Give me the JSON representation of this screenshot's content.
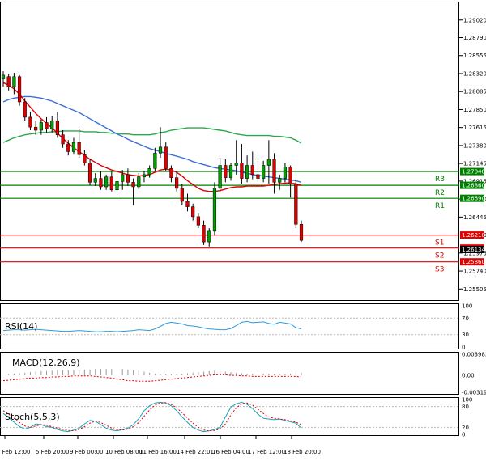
{
  "chart_data": [
    {
      "type": "candlestick",
      "panel": "price",
      "ylim": [
        1.2536,
        1.2925
      ],
      "y_ticks": [
        "1.29020",
        "1.28790",
        "1.28555",
        "1.28320",
        "1.28085",
        "1.27850",
        "1.27615",
        "1.27380",
        "1.27145",
        "1.26915",
        "1.26680",
        "1.26445",
        "1.26210",
        "1.25975",
        "1.25740",
        "1.25505"
      ],
      "x_labels": [
        "2 Feb 12:00",
        "5 Feb 20:00",
        "9 Feb 00:00",
        "10 Feb 08:00",
        "11 Feb 16:00",
        "14 Feb 22:01",
        "16 Feb 04:00",
        "17 Feb 12:00",
        "18 Feb 20:00"
      ],
      "colors": {
        "bull": "#00a000",
        "bear": "#e00000",
        "ma_fast": "#e00000",
        "ma_mid": "#3a6fd8",
        "ma_slow": "#2aa84a"
      },
      "candles": [
        [
          1.2825,
          1.2835,
          1.2815,
          1.283
        ],
        [
          1.2828,
          1.2832,
          1.281,
          1.2815
        ],
        [
          1.2815,
          1.2833,
          1.2805,
          1.2828
        ],
        [
          1.2828,
          1.283,
          1.279,
          1.2795
        ],
        [
          1.2795,
          1.28,
          1.277,
          1.2775
        ],
        [
          1.2775,
          1.2782,
          1.2758,
          1.2762
        ],
        [
          1.2762,
          1.277,
          1.2752,
          1.2758
        ],
        [
          1.2758,
          1.2772,
          1.2752,
          1.2768
        ],
        [
          1.2768,
          1.2775,
          1.2755,
          1.276
        ],
        [
          1.276,
          1.2776,
          1.2755,
          1.277
        ],
        [
          1.277,
          1.2782,
          1.2748,
          1.2752
        ],
        [
          1.2752,
          1.2758,
          1.2735,
          1.274
        ],
        [
          1.274,
          1.2745,
          1.2725,
          1.273
        ],
        [
          1.273,
          1.2748,
          1.2726,
          1.2742
        ],
        [
          1.2742,
          1.276,
          1.2722,
          1.2726
        ],
        [
          1.2726,
          1.2732,
          1.2712,
          1.2715
        ],
        [
          1.2715,
          1.272,
          1.2686,
          1.269
        ],
        [
          1.269,
          1.2702,
          1.2685,
          1.2695
        ],
        [
          1.2695,
          1.2705,
          1.268,
          1.2684
        ],
        [
          1.2684,
          1.27,
          1.268,
          1.2697
        ],
        [
          1.2697,
          1.2704,
          1.2678,
          1.268
        ],
        [
          1.268,
          1.2694,
          1.267,
          1.2691
        ],
        [
          1.2691,
          1.2706,
          1.268,
          1.27
        ],
        [
          1.27,
          1.2708,
          1.2685,
          1.269
        ],
        [
          1.269,
          1.2695,
          1.266,
          1.2684
        ],
        [
          1.2684,
          1.2702,
          1.2681,
          1.2697
        ],
        [
          1.2697,
          1.2705,
          1.269,
          1.27
        ],
        [
          1.27,
          1.2712,
          1.2696,
          1.2708
        ],
        [
          1.2708,
          1.2735,
          1.2704,
          1.2728
        ],
        [
          1.2728,
          1.2762,
          1.2722,
          1.2736
        ],
        [
          1.2736,
          1.2742,
          1.2704,
          1.2708
        ],
        [
          1.2708,
          1.2712,
          1.269,
          1.2696
        ],
        [
          1.2696,
          1.2705,
          1.2678,
          1.2682
        ],
        [
          1.2682,
          1.2688,
          1.266,
          1.2665
        ],
        [
          1.2665,
          1.2675,
          1.2652,
          1.2658
        ],
        [
          1.2658,
          1.2662,
          1.264,
          1.2645
        ],
        [
          1.2645,
          1.265,
          1.263,
          1.2634
        ],
        [
          1.2634,
          1.264,
          1.2608,
          1.2612
        ],
        [
          1.2612,
          1.263,
          1.2606,
          1.2626
        ],
        [
          1.2626,
          1.269,
          1.262,
          1.2682
        ],
        [
          1.2682,
          1.2722,
          1.2676,
          1.2712
        ],
        [
          1.2712,
          1.272,
          1.269,
          1.2696
        ],
        [
          1.2696,
          1.2715,
          1.2692,
          1.2712
        ],
        [
          1.2712,
          1.2745,
          1.27,
          1.2715
        ],
        [
          1.2715,
          1.274,
          1.2688,
          1.2695
        ],
        [
          1.2695,
          1.2725,
          1.269,
          1.2712
        ],
        [
          1.2712,
          1.273,
          1.2694,
          1.27
        ],
        [
          1.27,
          1.272,
          1.269,
          1.2695
        ],
        [
          1.2695,
          1.2718,
          1.269,
          1.2712
        ],
        [
          1.2712,
          1.2745,
          1.2688,
          1.272
        ],
        [
          1.272,
          1.2728,
          1.2675,
          1.269
        ],
        [
          1.269,
          1.27,
          1.268,
          1.2695
        ],
        [
          1.2695,
          1.2715,
          1.269,
          1.271
        ],
        [
          1.271,
          1.2712,
          1.267,
          1.2688
        ],
        [
          1.2688,
          1.2694,
          1.263,
          1.2635
        ],
        [
          1.2635,
          1.264,
          1.2612,
          1.2614
        ]
      ],
      "ma_fast": [
        1.282,
        1.2817,
        1.2812,
        1.2805,
        1.2796,
        1.2788,
        1.278,
        1.2773,
        1.2767,
        1.2761,
        1.2754,
        1.2747,
        1.2741,
        1.2735,
        1.273,
        1.2725,
        1.272,
        1.2716,
        1.2712,
        1.2709,
        1.2706,
        1.2704,
        1.2702,
        1.27,
        1.2699,
        1.2698,
        1.2699,
        1.27,
        1.2703,
        1.2706,
        1.2707,
        1.2706,
        1.2703,
        1.2698,
        1.2692,
        1.2687,
        1.2682,
        1.2679,
        1.2678,
        1.2678,
        1.2679,
        1.2681,
        1.2683,
        1.2684,
        1.2684,
        1.2685,
        1.2685,
        1.2685,
        1.2685,
        1.2686,
        1.2687,
        1.2688,
        1.2689,
        1.2689,
        1.2688,
        1.2686
      ],
      "ma_mid": [
        1.2795,
        1.2798,
        1.28,
        1.2801,
        1.2802,
        1.2802,
        1.2801,
        1.28,
        1.2798,
        1.2796,
        1.2793,
        1.279,
        1.2787,
        1.2784,
        1.2781,
        1.2777,
        1.2773,
        1.2769,
        1.2765,
        1.2761,
        1.2757,
        1.2753,
        1.275,
        1.2746,
        1.2743,
        1.274,
        1.2737,
        1.2734,
        1.2732,
        1.273,
        1.2728,
        1.2726,
        1.2724,
        1.2722,
        1.272,
        1.2717,
        1.2715,
        1.2713,
        1.2711,
        1.2709,
        1.2708,
        1.2707,
        1.2706,
        1.2705,
        1.2703,
        1.2702,
        1.27,
        1.2699,
        1.2698,
        1.2697,
        1.2696,
        1.2695,
        1.2694,
        1.2693,
        1.2692,
        1.269
      ],
      "ma_slow": [
        1.2742,
        1.2745,
        1.2748,
        1.275,
        1.2752,
        1.2753,
        1.2754,
        1.2755,
        1.2755,
        1.2756,
        1.2756,
        1.2757,
        1.2757,
        1.2757,
        1.2757,
        1.2756,
        1.2756,
        1.2756,
        1.2755,
        1.2755,
        1.2754,
        1.2754,
        1.2753,
        1.2753,
        1.2752,
        1.2752,
        1.2752,
        1.2752,
        1.2753,
        1.2755,
        1.2756,
        1.2758,
        1.2759,
        1.276,
        1.2761,
        1.2761,
        1.2761,
        1.2761,
        1.276,
        1.2759,
        1.2758,
        1.2757,
        1.2755,
        1.2753,
        1.2752,
        1.2751,
        1.2751,
        1.2751,
        1.2751,
        1.2751,
        1.275,
        1.275,
        1.2749,
        1.2748,
        1.2745,
        1.2741
      ],
      "levels": [
        {
          "label": "R3",
          "value": 1.2704,
          "price_tag": "1.27040",
          "color": "#008000"
        },
        {
          "label": "R2",
          "value": 1.2686,
          "price_tag": "1.26860",
          "color": "#008000"
        },
        {
          "label": "R1",
          "value": 1.2669,
          "price_tag": "1.26690",
          "color": "#008000"
        },
        {
          "label": "S1",
          "value": 1.2621,
          "price_tag": "1.26210",
          "color": "#e00000"
        },
        {
          "label": "S2",
          "value": 1.2604,
          "price_tag": "1.26040",
          "color": "#e00000"
        },
        {
          "label": "S3",
          "value": 1.2586,
          "price_tag": "1.25860",
          "color": "#e00000"
        }
      ],
      "current_price": {
        "value": 1.26134,
        "tag": "1.26134"
      }
    },
    {
      "type": "line",
      "panel": "rsi",
      "label": "RSI(14)",
      "ylim": [
        0,
        100
      ],
      "y_ticks": [
        "100",
        "70",
        "30",
        "0"
      ],
      "values": [
        40,
        41,
        42,
        42,
        41,
        42,
        43,
        42,
        41,
        40,
        39,
        38,
        38,
        39,
        40,
        39,
        38,
        37,
        37,
        38,
        38,
        37,
        38,
        39,
        40,
        42,
        41,
        40,
        44,
        50,
        57,
        60,
        58,
        56,
        52,
        51,
        49,
        46,
        44,
        43,
        42,
        42,
        45,
        52,
        60,
        62,
        59,
        60,
        61,
        57,
        55,
        60,
        58,
        56,
        47,
        44
      ]
    },
    {
      "type": "bar",
      "panel": "macd",
      "label": "MACD(12,26,9)",
      "ylim": [
        -0.003195,
        0.003982
      ],
      "y_ticks": [
        "0.003982",
        "0.00",
        "-0.003195"
      ],
      "histogram": [
        0.0,
        0.0002,
        0.0003,
        0.0004,
        0.0005,
        0.0006,
        0.0007,
        0.0008,
        0.0008,
        0.0009,
        0.001,
        0.001,
        0.001,
        0.001,
        0.0011,
        0.0011,
        0.0011,
        0.0012,
        0.0012,
        0.0012,
        0.0012,
        0.0012,
        0.0012,
        0.0011,
        0.001,
        0.0009,
        0.0007,
        0.0005,
        0.0003,
        0.0002,
        0.0002,
        0.0002,
        0.0002,
        0.0003,
        0.0004,
        0.0005,
        0.0006,
        0.0007,
        0.0008,
        0.0009,
        0.0008,
        0.0007,
        0.0006,
        0.0005,
        0.0004,
        0.0003,
        0.0003,
        0.0003,
        0.0003,
        0.0003,
        0.0002,
        0.0002,
        0.0002,
        0.0003,
        0.0004,
        0.0005
      ],
      "signal": [
        -0.001,
        -0.0009,
        -0.0008,
        -0.0007,
        -0.0006,
        -0.0005,
        -0.0005,
        -0.0004,
        -0.0004,
        -0.0003,
        -0.0003,
        -0.0002,
        -0.0002,
        -0.0001,
        -0.0001,
        -0.0001,
        -0.0001,
        -0.0002,
        -0.0003,
        -0.0004,
        -0.0005,
        -0.0007,
        -0.0008,
        -0.001,
        -0.001,
        -0.0011,
        -0.0011,
        -0.0011,
        -0.001,
        -0.0009,
        -0.0008,
        -0.0007,
        -0.0006,
        -0.0005,
        -0.0004,
        -0.0003,
        -0.0002,
        -0.0001,
        0.0,
        0.0001,
        0.0001,
        0.0001,
        0.0,
        0.0,
        -0.0001,
        -0.0001,
        -0.0002,
        -0.0002,
        -0.0002,
        -0.0002,
        -0.0002,
        -0.0002,
        -0.0002,
        -0.0002,
        -0.0002,
        -0.0003
      ]
    },
    {
      "type": "line",
      "panel": "stoch",
      "label": "Stoch(5,5,3)",
      "ylim": [
        0,
        100
      ],
      "y_ticks": [
        "100",
        "80",
        "20",
        "0"
      ],
      "series": [
        {
          "values": [
            60,
            48,
            35,
            22,
            15,
            20,
            30,
            28,
            22,
            20,
            14,
            10,
            8,
            12,
            18,
            30,
            40,
            38,
            28,
            18,
            12,
            10,
            14,
            18,
            28,
            45,
            68,
            82,
            90,
            92,
            90,
            82,
            68,
            50,
            34,
            20,
            12,
            8,
            10,
            14,
            20,
            50,
            78,
            88,
            92,
            86,
            74,
            58,
            46,
            44,
            42,
            44,
            40,
            36,
            32,
            18
          ],
          "color": "#17a2b8"
        },
        {
          "values": [
            68,
            58,
            46,
            34,
            24,
            20,
            24,
            28,
            26,
            22,
            18,
            14,
            11,
            10,
            14,
            22,
            32,
            38,
            34,
            26,
            18,
            13,
            12,
            15,
            22,
            34,
            52,
            70,
            84,
            90,
            91,
            86,
            76,
            62,
            46,
            32,
            20,
            12,
            10,
            11,
            15,
            30,
            56,
            76,
            88,
            90,
            84,
            72,
            60,
            50,
            46,
            44,
            42,
            39,
            35,
            28
          ],
          "color": "#e00000"
        }
      ]
    }
  ]
}
